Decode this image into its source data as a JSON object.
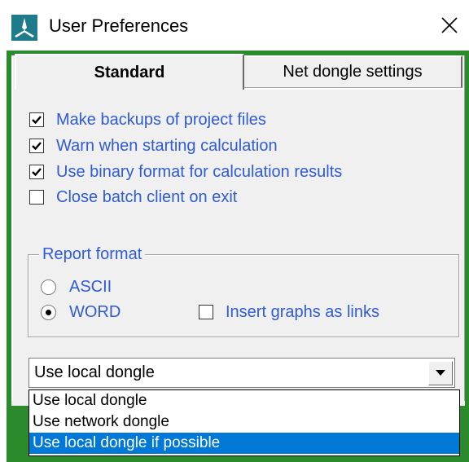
{
  "window": {
    "title": "User Preferences",
    "close_glyph": "×"
  },
  "tabs": [
    {
      "label": "Standard",
      "active": true
    },
    {
      "label": "Net dongle settings",
      "active": false
    }
  ],
  "options": [
    {
      "label": "Make backups of project files",
      "checked": true
    },
    {
      "label": "Warn when starting calculation",
      "checked": true
    },
    {
      "label": "Use binary format for calculation results",
      "checked": true
    },
    {
      "label": "Close batch client on exit",
      "checked": false
    }
  ],
  "report_format": {
    "legend": "Report format",
    "radios": [
      {
        "label": "ASCII",
        "selected": false
      },
      {
        "label": "WORD",
        "selected": true
      }
    ],
    "insert_graphs": {
      "label": "Insert graphs as links",
      "checked": false
    }
  },
  "dongle_select": {
    "value": "Use local dongle",
    "options": [
      "Use local dongle",
      "Use network dongle",
      "Use local dongle if possible"
    ],
    "highlighted": "Use local dongle if possible"
  },
  "colors": {
    "label_blue": "#2f5bd4",
    "frame_green": "#2b8a2b",
    "selection_blue": "#0078d7",
    "icon_teal": "#1e7b8a"
  }
}
